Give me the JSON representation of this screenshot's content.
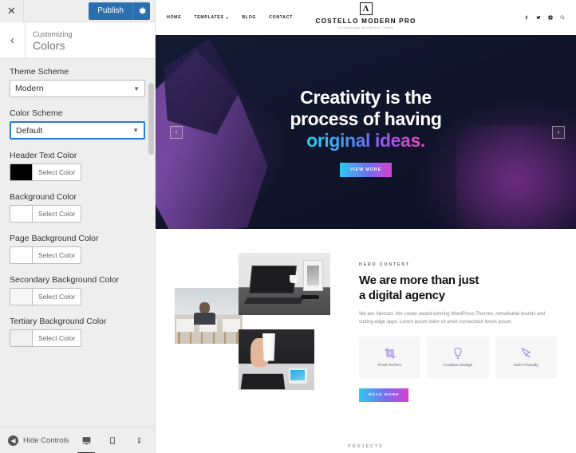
{
  "customizer": {
    "topbar": {
      "close_label": "✕",
      "publish_label": "Publish",
      "gear_icon": "gear-icon"
    },
    "header": {
      "back_label": "‹",
      "subtitle": "Customizing",
      "title": "Colors"
    },
    "controls": [
      {
        "label": "Theme Scheme",
        "type": "select",
        "value": "Modern",
        "focused": false
      },
      {
        "label": "Color Scheme",
        "type": "select",
        "value": "Default",
        "focused": true
      },
      {
        "label": "Header Text Color",
        "type": "color",
        "button": "Select Color",
        "swatch": "#000000"
      },
      {
        "label": "Background Color",
        "type": "color",
        "button": "Select Color",
        "swatch": "#ffffff"
      },
      {
        "label": "Page Background Color",
        "type": "color",
        "button": "Select Color",
        "swatch": "#ffffff"
      },
      {
        "label": "Secondary Background Color",
        "type": "color",
        "button": "Select Color",
        "swatch": "#f7f7f7"
      },
      {
        "label": "Tertiary Background Color",
        "type": "color",
        "button": "Select Color",
        "swatch": "#f0f0f0"
      }
    ],
    "footer": {
      "hide_controls_label": "Hide Controls",
      "devices": [
        {
          "name": "desktop",
          "active": true
        },
        {
          "name": "tablet",
          "active": false
        },
        {
          "name": "mobile",
          "active": false
        }
      ]
    }
  },
  "preview": {
    "nav": [
      {
        "label": "HOME",
        "has_dropdown": false
      },
      {
        "label": "TEMPLATES",
        "has_dropdown": true
      },
      {
        "label": "BLOG",
        "has_dropdown": false
      },
      {
        "label": "CONTACT",
        "has_dropdown": false
      }
    ],
    "brand": {
      "mark": "Λ",
      "name": "COSTELLO MODERN PRO",
      "tagline": "Professional WordPress Theme"
    },
    "social": [
      "facebook-icon",
      "twitter-icon",
      "instagram-icon",
      "search-icon"
    ],
    "hero": {
      "line1": "Creativity is the",
      "line2": "process of having",
      "line3": "original ideas.",
      "button": "VIEW MORE",
      "prev_arrow": "‹",
      "next_arrow": "›",
      "gradient_from": "#29d3f0",
      "gradient_to": "#ef4bb4"
    },
    "content": {
      "eyebrow": "HERO CONTENT",
      "heading_line1": "We are more than just",
      "heading_line2": "a digital agency",
      "paragraph": "We are Abstract. We create award-winning WordPress Themes, remarkable brands and cutting-edge apps. Lorem ipsum dolor sit amet consectetur lorem ipsum.",
      "features": [
        {
          "label": "Pixel Perfect",
          "icon": "crop-icon"
        },
        {
          "label": "Creative Design",
          "icon": "lightbulb-icon"
        },
        {
          "label": "User Friendly",
          "icon": "cursor-icon"
        }
      ],
      "read_more": "READ MORE"
    },
    "projects_eyebrow": "PROJECTS"
  }
}
